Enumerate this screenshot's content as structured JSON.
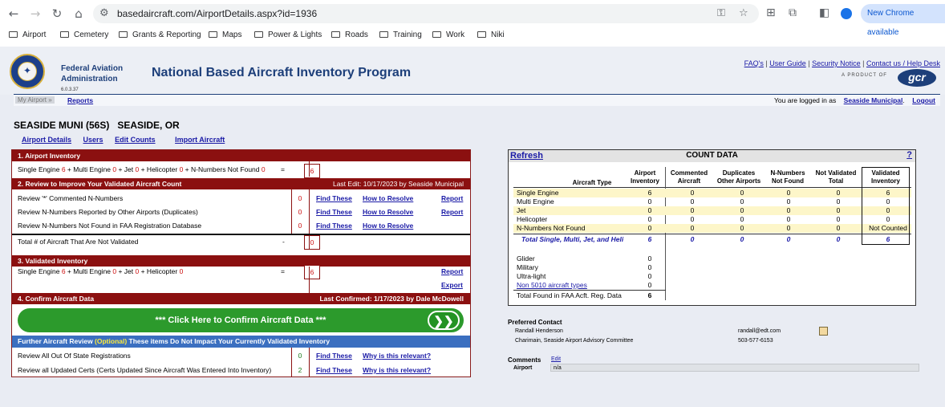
{
  "browser": {
    "url": "basedaircraft.com/AirportDetails.aspx?id=1936",
    "new_chrome": "New Chrome available",
    "bookmarks": [
      "Airport",
      "Cemetery",
      "Grants & Reporting",
      "Maps",
      "Power & Lights",
      "Roads",
      "Training",
      "Work",
      "Niki"
    ]
  },
  "header": {
    "agency_line1": "Federal Aviation",
    "agency_line2": "Administration",
    "version": "6.0.3.37",
    "program_title": "National Based Aircraft Inventory Program",
    "links": [
      "FAQ's",
      "User Guide",
      "Security Notice",
      "Contact us / Help Desk"
    ],
    "product_of": "A PRODUCT OF",
    "gcr": "gcr"
  },
  "menu": {
    "current": "My Airport »",
    "reports": "Reports",
    "logged_in_text": "You are logged in as",
    "user": "Seaside Municipal",
    "period": ".",
    "logout": "Logout"
  },
  "airport": {
    "name": "SEASIDE MUNI (56S)   SEASIDE, OR",
    "links": [
      "Airport Details",
      "Users",
      "Edit Counts",
      "Import Aircraft"
    ]
  },
  "left": {
    "s1_title": "1. Airport Inventory",
    "s1_formula": [
      {
        "t": "Single Engine ",
        "v": "6"
      },
      {
        "t": " + Multi Engine ",
        "v": "0"
      },
      {
        "t": " + Jet ",
        "v": "0"
      },
      {
        "t": " + Helicopter ",
        "v": "0"
      },
      {
        "t": " + N-Numbers Not Found ",
        "v": "0"
      }
    ],
    "s1_eq": "=",
    "s1_total": "6",
    "s2_title": "2. Review to Improve Your Validated Aircraft Count",
    "s2_last_edit": "Last Edit: 10/17/2023 by Seaside Municipal",
    "s2_rows": [
      {
        "label": "Review '*' Commented N-Numbers",
        "count": "0",
        "find": "Find These",
        "how": "How to Resolve",
        "report": "Report"
      },
      {
        "label": "Review N-Numbers Reported by Other Airports (Duplicates)",
        "count": "0",
        "find": "Find These",
        "how": "How to Resolve",
        "report": "Report"
      },
      {
        "label": "Review N-Numbers Not Found in FAA Registration Database",
        "count": "0",
        "find": "Find These",
        "how": "How to Resolve",
        "report": ""
      }
    ],
    "not_validated_label": "Total # of Aircraft That Are Not Validated",
    "not_validated_dash": "-",
    "not_validated_count": "0",
    "s3_title": "3. Validated Inventory",
    "s3_formula": [
      {
        "t": "Single Engine ",
        "v": "6"
      },
      {
        "t": " + Multi Engine ",
        "v": "0"
      },
      {
        "t": " + Jet ",
        "v": "0"
      },
      {
        "t": " + Helicopter ",
        "v": "0"
      }
    ],
    "s3_eq": "=",
    "s3_total": "6",
    "s3_report": "Report",
    "s3_export": "Export",
    "s4_title": "4. Confirm Aircraft Data",
    "s4_last": "Last Confirmed: 1/17/2023 by Dale McDowell",
    "confirm_label": "*** Click Here to Confirm Aircraft Data ***",
    "confirm_arrow": "❯❯",
    "further_a": "Further Aircraft Review ",
    "further_opt": "(Optional)",
    "further_b": " These items Do Not Impact Your Currently Validated Inventory",
    "further_rows": [
      {
        "label": "Review All Out Of State Registrations",
        "count": "0",
        "find": "Find These",
        "why": "Why is this relevant?"
      },
      {
        "label": "Review all Updated Certs (Certs Updated Since Aircraft Was Entered Into Inventory)",
        "count": "2",
        "find": "Find These",
        "why": "Why is this relevant?"
      }
    ]
  },
  "count_data": {
    "refresh": "Refresh",
    "title": "COUNT DATA",
    "help": "?",
    "col_type": "Aircraft Type",
    "columns": [
      {
        "l1": "Airport",
        "l2": "Inventory"
      },
      {
        "l1": "Commented",
        "l2": "Aircraft"
      },
      {
        "l1": "Duplicates",
        "l2": "Other Airports"
      },
      {
        "l1": "N-Numbers",
        "l2": "Not Found"
      },
      {
        "l1": "Not Validated",
        "l2": "Total"
      },
      {
        "l1": "Validated",
        "l2": "Inventory"
      }
    ],
    "rows": [
      {
        "name": "Single Engine",
        "v": [
          "6",
          "0",
          "0",
          "0",
          "0",
          "6"
        ]
      },
      {
        "name": "Multi Engine",
        "v": [
          "0",
          "0",
          "0",
          "0",
          "0",
          "0"
        ]
      },
      {
        "name": "Jet",
        "v": [
          "0",
          "0",
          "0",
          "0",
          "0",
          "0"
        ]
      },
      {
        "name": "Helicopter",
        "v": [
          "0",
          "0",
          "0",
          "0",
          "0",
          "0"
        ]
      },
      {
        "name": "N-Numbers Not Found",
        "v": [
          "0",
          "0",
          "0",
          "0",
          "0",
          "Not Counted"
        ]
      }
    ],
    "total": {
      "name": "Total Single, Multi, Jet, and Heli",
      "v": [
        "6",
        "0",
        "0",
        "0",
        "0",
        "6"
      ]
    },
    "other": [
      {
        "name": "Glider",
        "v": "0"
      },
      {
        "name": "Military",
        "v": "0"
      },
      {
        "name": "Ultra-light",
        "v": "0"
      },
      {
        "name": "Non 5010 aircraft types",
        "v": "0"
      }
    ],
    "faa_total": {
      "name": "Total Found in FAA Acft. Reg. Data",
      "v": "6"
    }
  },
  "contact": {
    "heading": "Preferred Contact",
    "name": "Randall Henderson",
    "email": "randall@edt.com",
    "role": "Charimain, Seaside Airport Advisory Committee",
    "phone": "503-577-6153",
    "comments": "Comments",
    "edit": "Edit",
    "airport_label": "Airport",
    "airport_value": "n/a"
  }
}
